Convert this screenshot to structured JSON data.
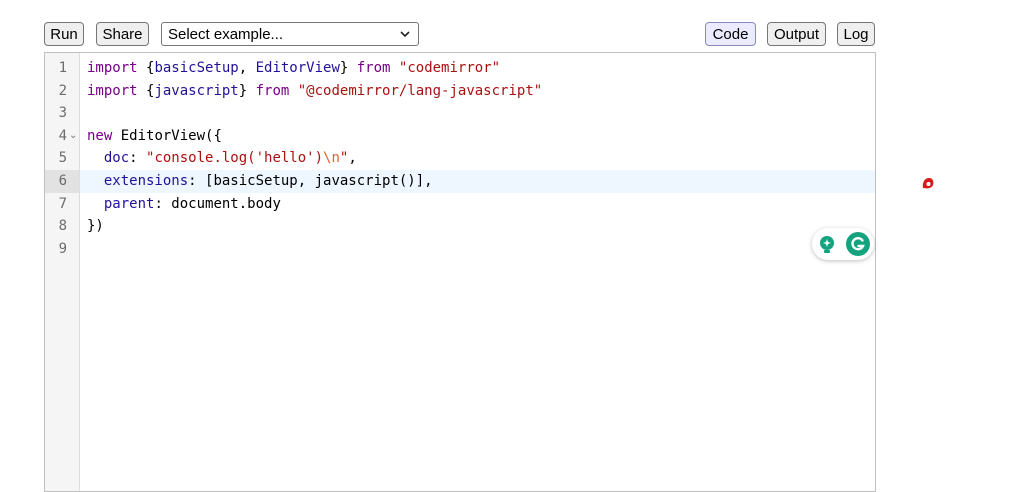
{
  "toolbar": {
    "run_label": "Run",
    "share_label": "Share",
    "example_select": {
      "value": "Select example..."
    },
    "code_label": "Code",
    "output_label": "Output",
    "log_label": "Log",
    "active_tab": "Code"
  },
  "editor": {
    "line_numbers": [
      "1",
      "2",
      "3",
      "4",
      "5",
      "6",
      "7",
      "8",
      "9"
    ],
    "active_line": 6,
    "folded_line": 4
  },
  "code": {
    "l1": {
      "t1": "import",
      "t2": " {",
      "t3": "basicSetup",
      "t4": ", ",
      "t5": "EditorView",
      "t6": "} ",
      "t7": "from",
      "t8": " ",
      "t9": "\"codemirror\""
    },
    "l2": {
      "t1": "import",
      "t2": " {",
      "t3": "javascript",
      "t4": "} ",
      "t5": "from",
      "t6": " ",
      "t7": "\"@codemirror/lang-javascript\""
    },
    "l4": {
      "t1": "new",
      "t2": " EditorView({"
    },
    "l5": {
      "t1": "  ",
      "t2": "doc",
      "t3": ": ",
      "t4": "\"console.log('hello')",
      "t5": "\\n",
      "t6": "\"",
      "t7": ","
    },
    "l6": {
      "t1": "  ",
      "t2": "extensions",
      "t3": ": [basicSetup, javascript()],"
    },
    "l7": {
      "t1": "  ",
      "t2": "parent",
      "t3": ": document.body"
    },
    "l8": {
      "t1": "})"
    }
  },
  "icons": {
    "fold_marker": "⌄",
    "lightbulb": "lightbulb-icon",
    "grammarly": "grammarly-icon"
  },
  "colors": {
    "keyword": "#770088",
    "variable": "#221199",
    "string": "#aa1111",
    "escape": "#e0632a",
    "active_line": "#eef6ff",
    "grammarly_green": "#15a37f"
  }
}
